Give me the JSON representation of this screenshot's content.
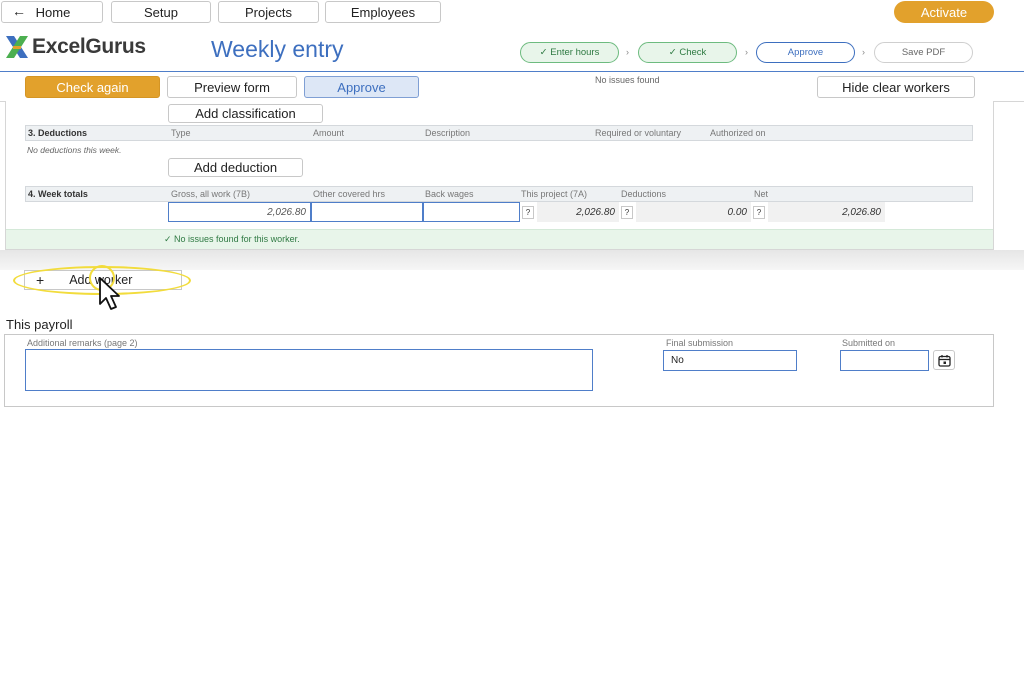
{
  "nav": {
    "home_label": "Home",
    "setup_label": "Setup",
    "projects_label": "Projects",
    "employees_label": "Employees",
    "activate_label": "Activate"
  },
  "header": {
    "logo_text": "ExcelGurus",
    "page_title": "Weekly entry",
    "steps": [
      {
        "label": "✓ Enter hours",
        "state": "done"
      },
      {
        "label": "✓ Check",
        "state": "done"
      },
      {
        "label": "Approve",
        "state": "current"
      },
      {
        "label": "Save PDF",
        "state": "todo"
      }
    ],
    "step_separator": "›"
  },
  "toolbar": {
    "check_again_label": "Check again",
    "preview_form_label": "Preview form",
    "approve_label": "Approve",
    "status_text": "No issues found",
    "hide_clear_workers_label": "Hide clear workers"
  },
  "worker": {
    "add_classification_label": "Add classification",
    "deductions": {
      "title": "3. Deductions",
      "columns": [
        "Type",
        "Amount",
        "Description",
        "Required or voluntary",
        "Authorized on"
      ],
      "empty_text": "No deductions this week.",
      "add_label": "Add deduction"
    },
    "totals": {
      "title": "4. Week totals",
      "columns": [
        "Gross, all work (7B)",
        "Other covered hrs",
        "Back wages",
        "This project (7A)",
        "Deductions",
        "Net"
      ],
      "gross": "2,026.80",
      "other_covered_hrs": "",
      "back_wages": "",
      "this_project": "2,026.80",
      "deductions": "0.00",
      "net": "2,026.80",
      "help_glyph": "?"
    },
    "status_text": "✓  No issues found for this worker."
  },
  "add_worker": {
    "plus": "+",
    "label": "Add worker"
  },
  "payroll": {
    "title": "This payroll",
    "remarks_label": "Additional remarks (page 2)",
    "remarks_value": "",
    "final_submission_label": "Final submission",
    "final_submission_value": "No",
    "submitted_on_label": "Submitted on",
    "submitted_on_value": ""
  },
  "colors": {
    "accent_blue": "#3d6fbf",
    "accent_orange": "#e2a12c",
    "success_green": "#2f7a43",
    "highlight_yellow": "#f2dc3c"
  }
}
